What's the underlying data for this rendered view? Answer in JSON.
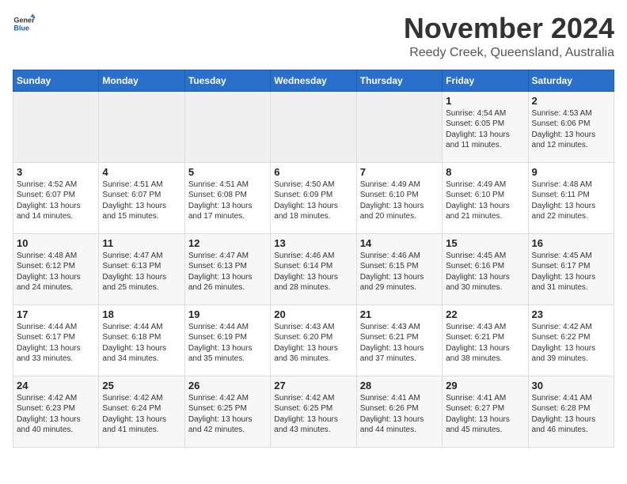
{
  "header": {
    "logo_general": "General",
    "logo_blue": "Blue",
    "month": "November 2024",
    "location": "Reedy Creek, Queensland, Australia"
  },
  "weekdays": [
    "Sunday",
    "Monday",
    "Tuesday",
    "Wednesday",
    "Thursday",
    "Friday",
    "Saturday"
  ],
  "weeks": [
    [
      {
        "day": "",
        "sunrise": "",
        "sunset": "",
        "daylight": ""
      },
      {
        "day": "",
        "sunrise": "",
        "sunset": "",
        "daylight": ""
      },
      {
        "day": "",
        "sunrise": "",
        "sunset": "",
        "daylight": ""
      },
      {
        "day": "",
        "sunrise": "",
        "sunset": "",
        "daylight": ""
      },
      {
        "day": "",
        "sunrise": "",
        "sunset": "",
        "daylight": ""
      },
      {
        "day": "1",
        "sunrise": "Sunrise: 4:54 AM",
        "sunset": "Sunset: 6:05 PM",
        "daylight": "Daylight: 13 hours and 11 minutes."
      },
      {
        "day": "2",
        "sunrise": "Sunrise: 4:53 AM",
        "sunset": "Sunset: 6:06 PM",
        "daylight": "Daylight: 13 hours and 12 minutes."
      }
    ],
    [
      {
        "day": "3",
        "sunrise": "Sunrise: 4:52 AM",
        "sunset": "Sunset: 6:07 PM",
        "daylight": "Daylight: 13 hours and 14 minutes."
      },
      {
        "day": "4",
        "sunrise": "Sunrise: 4:51 AM",
        "sunset": "Sunset: 6:07 PM",
        "daylight": "Daylight: 13 hours and 15 minutes."
      },
      {
        "day": "5",
        "sunrise": "Sunrise: 4:51 AM",
        "sunset": "Sunset: 6:08 PM",
        "daylight": "Daylight: 13 hours and 17 minutes."
      },
      {
        "day": "6",
        "sunrise": "Sunrise: 4:50 AM",
        "sunset": "Sunset: 6:09 PM",
        "daylight": "Daylight: 13 hours and 18 minutes."
      },
      {
        "day": "7",
        "sunrise": "Sunrise: 4:49 AM",
        "sunset": "Sunset: 6:10 PM",
        "daylight": "Daylight: 13 hours and 20 minutes."
      },
      {
        "day": "8",
        "sunrise": "Sunrise: 4:49 AM",
        "sunset": "Sunset: 6:10 PM",
        "daylight": "Daylight: 13 hours and 21 minutes."
      },
      {
        "day": "9",
        "sunrise": "Sunrise: 4:48 AM",
        "sunset": "Sunset: 6:11 PM",
        "daylight": "Daylight: 13 hours and 22 minutes."
      }
    ],
    [
      {
        "day": "10",
        "sunrise": "Sunrise: 4:48 AM",
        "sunset": "Sunset: 6:12 PM",
        "daylight": "Daylight: 13 hours and 24 minutes."
      },
      {
        "day": "11",
        "sunrise": "Sunrise: 4:47 AM",
        "sunset": "Sunset: 6:13 PM",
        "daylight": "Daylight: 13 hours and 25 minutes."
      },
      {
        "day": "12",
        "sunrise": "Sunrise: 4:47 AM",
        "sunset": "Sunset: 6:13 PM",
        "daylight": "Daylight: 13 hours and 26 minutes."
      },
      {
        "day": "13",
        "sunrise": "Sunrise: 4:46 AM",
        "sunset": "Sunset: 6:14 PM",
        "daylight": "Daylight: 13 hours and 28 minutes."
      },
      {
        "day": "14",
        "sunrise": "Sunrise: 4:46 AM",
        "sunset": "Sunset: 6:15 PM",
        "daylight": "Daylight: 13 hours and 29 minutes."
      },
      {
        "day": "15",
        "sunrise": "Sunrise: 4:45 AM",
        "sunset": "Sunset: 6:16 PM",
        "daylight": "Daylight: 13 hours and 30 minutes."
      },
      {
        "day": "16",
        "sunrise": "Sunrise: 4:45 AM",
        "sunset": "Sunset: 6:17 PM",
        "daylight": "Daylight: 13 hours and 31 minutes."
      }
    ],
    [
      {
        "day": "17",
        "sunrise": "Sunrise: 4:44 AM",
        "sunset": "Sunset: 6:17 PM",
        "daylight": "Daylight: 13 hours and 33 minutes."
      },
      {
        "day": "18",
        "sunrise": "Sunrise: 4:44 AM",
        "sunset": "Sunset: 6:18 PM",
        "daylight": "Daylight: 13 hours and 34 minutes."
      },
      {
        "day": "19",
        "sunrise": "Sunrise: 4:44 AM",
        "sunset": "Sunset: 6:19 PM",
        "daylight": "Daylight: 13 hours and 35 minutes."
      },
      {
        "day": "20",
        "sunrise": "Sunrise: 4:43 AM",
        "sunset": "Sunset: 6:20 PM",
        "daylight": "Daylight: 13 hours and 36 minutes."
      },
      {
        "day": "21",
        "sunrise": "Sunrise: 4:43 AM",
        "sunset": "Sunset: 6:21 PM",
        "daylight": "Daylight: 13 hours and 37 minutes."
      },
      {
        "day": "22",
        "sunrise": "Sunrise: 4:43 AM",
        "sunset": "Sunset: 6:21 PM",
        "daylight": "Daylight: 13 hours and 38 minutes."
      },
      {
        "day": "23",
        "sunrise": "Sunrise: 4:42 AM",
        "sunset": "Sunset: 6:22 PM",
        "daylight": "Daylight: 13 hours and 39 minutes."
      }
    ],
    [
      {
        "day": "24",
        "sunrise": "Sunrise: 4:42 AM",
        "sunset": "Sunset: 6:23 PM",
        "daylight": "Daylight: 13 hours and 40 minutes."
      },
      {
        "day": "25",
        "sunrise": "Sunrise: 4:42 AM",
        "sunset": "Sunset: 6:24 PM",
        "daylight": "Daylight: 13 hours and 41 minutes."
      },
      {
        "day": "26",
        "sunrise": "Sunrise: 4:42 AM",
        "sunset": "Sunset: 6:25 PM",
        "daylight": "Daylight: 13 hours and 42 minutes."
      },
      {
        "day": "27",
        "sunrise": "Sunrise: 4:42 AM",
        "sunset": "Sunset: 6:25 PM",
        "daylight": "Daylight: 13 hours and 43 minutes."
      },
      {
        "day": "28",
        "sunrise": "Sunrise: 4:41 AM",
        "sunset": "Sunset: 6:26 PM",
        "daylight": "Daylight: 13 hours and 44 minutes."
      },
      {
        "day": "29",
        "sunrise": "Sunrise: 4:41 AM",
        "sunset": "Sunset: 6:27 PM",
        "daylight": "Daylight: 13 hours and 45 minutes."
      },
      {
        "day": "30",
        "sunrise": "Sunrise: 4:41 AM",
        "sunset": "Sunset: 6:28 PM",
        "daylight": "Daylight: 13 hours and 46 minutes."
      }
    ]
  ]
}
